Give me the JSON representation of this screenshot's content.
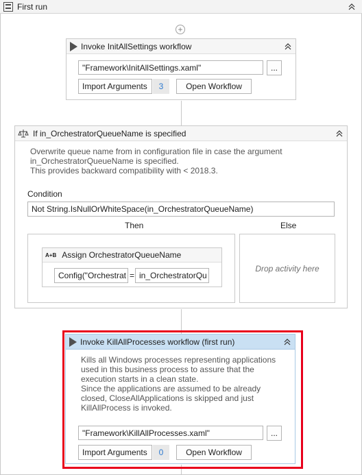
{
  "sequence": {
    "title": "First run"
  },
  "invoke_init": {
    "title": "Invoke InitAllSettings workflow",
    "file": "\"Framework\\InitAllSettings.xaml\"",
    "browse_label": "...",
    "import_label": "Import Arguments",
    "import_count": "3",
    "open_label": "Open Workflow"
  },
  "if_block": {
    "title": "If in_OrchestratorQueueName is specified",
    "description_lines": [
      "Overwrite queue name from in configuration file in case the argument",
      "in_OrchestratorQueueName is specified.",
      "This provides backward compatibility with < 2018.3."
    ],
    "condition_label": "Condition",
    "condition_value": "Not String.IsNullOrWhiteSpace(in_OrchestratorQueueName)",
    "then_label": "Then",
    "else_label": "Else",
    "assign": {
      "title": "Assign OrchestratorQueueName",
      "icon_text": "A+B",
      "left_value": "Config(\"Orchestrat",
      "equals": "=",
      "right_value": "in_OrchestratorQu"
    },
    "drop_text": "Drop activity here"
  },
  "invoke_kill": {
    "title": "Invoke KillAllProcesses workflow (first run)",
    "description_lines": [
      "Kills all Windows processes representing applications",
      "used in this business process to assure that the",
      "execution starts in a clean state.",
      "Since the applications are assumed to be already",
      "closed, CloseAllApplications is skipped and just",
      "KillAllProcess is invoked."
    ],
    "file": "\"Framework\\KillAllProcesses.xaml\"",
    "browse_label": "...",
    "import_label": "Import Arguments",
    "import_count": "0",
    "open_label": "Open Workflow"
  },
  "colors": {
    "selection_highlight": "#e8001c",
    "selected_header": "#c9e0f3",
    "count_text": "#2f7bd0"
  }
}
